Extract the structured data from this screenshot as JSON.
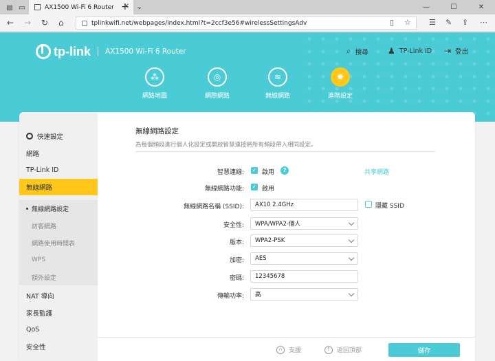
{
  "browser": {
    "tab_title": "AX1500 Wi-Fi 6 Router",
    "url": "tplinkwifi.net/webpages/index.html?t=2ccf3e56#wirelessSettingsAdv"
  },
  "header": {
    "logo": "tp-link",
    "model": "AX1500 Wi-Fi 6 Router",
    "search_label": "搜尋",
    "tplink_id_label": "TP-Link ID",
    "logout_label": "登出"
  },
  "main_nav": [
    {
      "label": "網路地圖",
      "icon": "network-map-icon"
    },
    {
      "label": "網際網路",
      "icon": "globe-icon"
    },
    {
      "label": "無線網路",
      "icon": "wifi-icon"
    },
    {
      "label": "進階設定",
      "icon": "gear-icon",
      "active": true
    }
  ],
  "sidebar": {
    "items": [
      {
        "label": "快速設定"
      },
      {
        "label": "網路"
      },
      {
        "label": "TP-Link ID"
      },
      {
        "label": "無線網路"
      },
      {
        "label": "NAT 導向"
      },
      {
        "label": "家長監護"
      },
      {
        "label": "QoS"
      },
      {
        "label": "安全性"
      }
    ],
    "sub_items": [
      {
        "label": "無線網路設定"
      },
      {
        "label": "訪客網路"
      },
      {
        "label": "網路使用時間表"
      },
      {
        "label": "WPS"
      },
      {
        "label": "額外設定"
      }
    ]
  },
  "form": {
    "title": "無線網路設定",
    "description": "為每個頻段進行個人化設定或開啟智慧連接將所有頻段帶入相同設定。",
    "smart_connect_label": "智慧連線:",
    "smart_connect_text": "啟用",
    "share_network_link": "共享網路",
    "wireless_func_label": "無線網路功能:",
    "wireless_func_text": "啟用",
    "ssid_label": "無線網路名稱 (SSID):",
    "ssid_value": "AX10 2.4GHz",
    "hide_ssid_label": "隱藏 SSID",
    "security_label": "安全性:",
    "security_value": "WPA/WPA2-個人",
    "version_label": "版本:",
    "version_value": "WPA2-PSK",
    "encryption_label": "加密:",
    "encryption_value": "AES",
    "password_label": "密碼:",
    "password_value": "12345678",
    "tx_power_label": "傳輸功率:",
    "tx_power_value": "高"
  },
  "footer": {
    "support_label": "支援",
    "back_to_top_label": "返回頂部",
    "save_label": "儲存"
  },
  "colors": {
    "accent": "#4acbd6",
    "active": "#ffc81a"
  }
}
